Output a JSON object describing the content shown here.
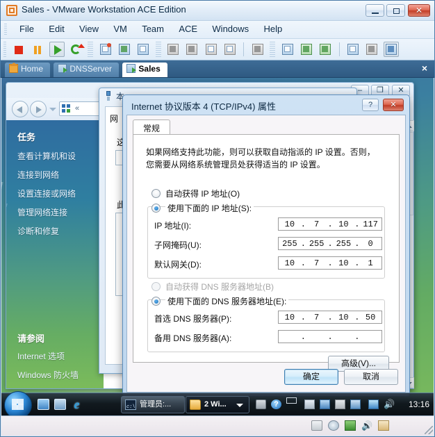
{
  "window": {
    "title": "Sales - VMware Workstation ACE Edition",
    "icon": "vmware-icon",
    "buttons": {
      "minimize": "minimize",
      "maximize": "maximize",
      "close": "close"
    }
  },
  "menubar": {
    "items": [
      {
        "label": "File"
      },
      {
        "label": "Edit"
      },
      {
        "label": "View"
      },
      {
        "label": "VM"
      },
      {
        "label": "Team"
      },
      {
        "label": "ACE"
      },
      {
        "label": "Windows"
      },
      {
        "label": "Help"
      }
    ]
  },
  "toolbar": {
    "buttons": [
      {
        "name": "power-off-icon"
      },
      {
        "name": "suspend-icon"
      },
      {
        "name": "power-on-icon"
      },
      {
        "name": "reset-icon"
      },
      {
        "name": "snapshot-icon"
      },
      {
        "name": "revert-snapshot-icon"
      },
      {
        "name": "snapshot-manager-icon"
      },
      {
        "name": "clone-icon"
      },
      {
        "name": "clone-multiple-icon"
      },
      {
        "name": "capture-screen-icon"
      },
      {
        "name": "capture-movie-icon"
      },
      {
        "name": "vm-settings-icon"
      },
      {
        "name": "show-sidebar-icon"
      },
      {
        "name": "fullscreen-icon"
      },
      {
        "name": "quick-switch-icon"
      },
      {
        "name": "preferences-icon"
      },
      {
        "name": "summary-view-icon"
      },
      {
        "name": "console-view-icon"
      }
    ]
  },
  "tabs": {
    "items": [
      {
        "label": "Home",
        "icon": "home-icon",
        "active": false
      },
      {
        "label": "DNSServer",
        "icon": "vm-icon",
        "active": false
      },
      {
        "label": "Sales",
        "icon": "vm-icon",
        "active": true
      }
    ],
    "close_label": "×"
  },
  "explorer": {
    "title_buttons": {
      "minimize": "–",
      "maximize": "❐",
      "close": "✕"
    },
    "nav": {
      "back": "back-button",
      "forward": "forward-button",
      "dropdown": "recent-pages-dropdown"
    },
    "breadcrumb": "«",
    "search_placeholder": "",
    "sidebar": {
      "tasks_header": "任务",
      "tasks": [
        {
          "label": "查看计算机和设"
        },
        {
          "label": "连接到网络"
        },
        {
          "label": "设置连接或网络"
        },
        {
          "label": "管理网络连接"
        },
        {
          "label": "诊断和修复"
        }
      ],
      "seealso_header": "请参阅",
      "seealso": [
        {
          "label": "Internet 选项"
        },
        {
          "label": "Windows 防火墙"
        }
      ]
    }
  },
  "mid_window": {
    "title": "本",
    "lines": [
      {
        "text": "网"
      },
      {
        "text": "这"
      },
      {
        "text": "此"
      }
    ]
  },
  "dialog": {
    "title": "Internet 协议版本 4 (TCP/IPv4) 属性",
    "help_label": "?",
    "close_label": "✕",
    "tab_label": "常规",
    "description": [
      "如果网络支持此功能，则可以获取自动指派的 IP 设置。否则，",
      "您需要从网络系统管理员处获得适当的 IP 设置。"
    ],
    "ip_auto": {
      "label": "自动获得 IP 地址(O)",
      "checked": false,
      "disabled": false
    },
    "ip_manual": {
      "label": "使用下面的 IP 地址(S):",
      "checked": true
    },
    "ip_address": {
      "label": "IP 地址(I):",
      "octets": [
        "10",
        "7",
        "10",
        "117"
      ]
    },
    "subnet_mask": {
      "label": "子网掩码(U):",
      "octets": [
        "255",
        "255",
        "255",
        "0"
      ]
    },
    "default_gateway": {
      "label": "默认网关(D):",
      "octets": [
        "10",
        "7",
        "10",
        "1"
      ]
    },
    "dns_auto": {
      "label": "自动获得 DNS 服务器地址(B)",
      "checked": false,
      "disabled": true
    },
    "dns_manual": {
      "label": "使用下面的 DNS 服务器地址(E):",
      "checked": true
    },
    "dns_preferred": {
      "label": "首选 DNS 服务器(P):",
      "octets": [
        "10",
        "7",
        "10",
        "50"
      ]
    },
    "dns_alternate": {
      "label": "备用 DNS 服务器(A):",
      "octets": [
        "",
        "",
        "",
        ""
      ],
      "empty": true
    },
    "advanced_button": "高级(V)...",
    "ok_button": "确定",
    "cancel_button": "取消"
  },
  "guest_taskbar": {
    "start": "start-orb",
    "quick_launch": [
      {
        "name": "show-desktop-icon"
      },
      {
        "name": "switch-windows-icon"
      },
      {
        "name": "internet-explorer-icon",
        "glyph": "e"
      }
    ],
    "tasks": [
      {
        "label": "管理员:...",
        "icon": "command-prompt-icon"
      },
      {
        "label": "2 Wi...",
        "icon": "folder-icon",
        "grouped": true
      }
    ],
    "tray": [
      {
        "name": "keyboard-icon"
      },
      {
        "name": "help-icon"
      },
      {
        "name": "overflow-icon"
      },
      {
        "name": "action-center-icon"
      },
      {
        "name": "update-icon"
      },
      {
        "name": "security-icon"
      },
      {
        "name": "network-manager-icon"
      },
      {
        "name": "network-icon"
      },
      {
        "name": "volume-muted-icon"
      }
    ],
    "clock": "13:16"
  },
  "statusbar": {
    "devices": [
      {
        "name": "hard-disk-icon"
      },
      {
        "name": "cd-dvd-disabled-icon"
      },
      {
        "name": "network-adapter-icon"
      },
      {
        "name": "sound-icon"
      },
      {
        "name": "usb-icon"
      }
    ]
  }
}
